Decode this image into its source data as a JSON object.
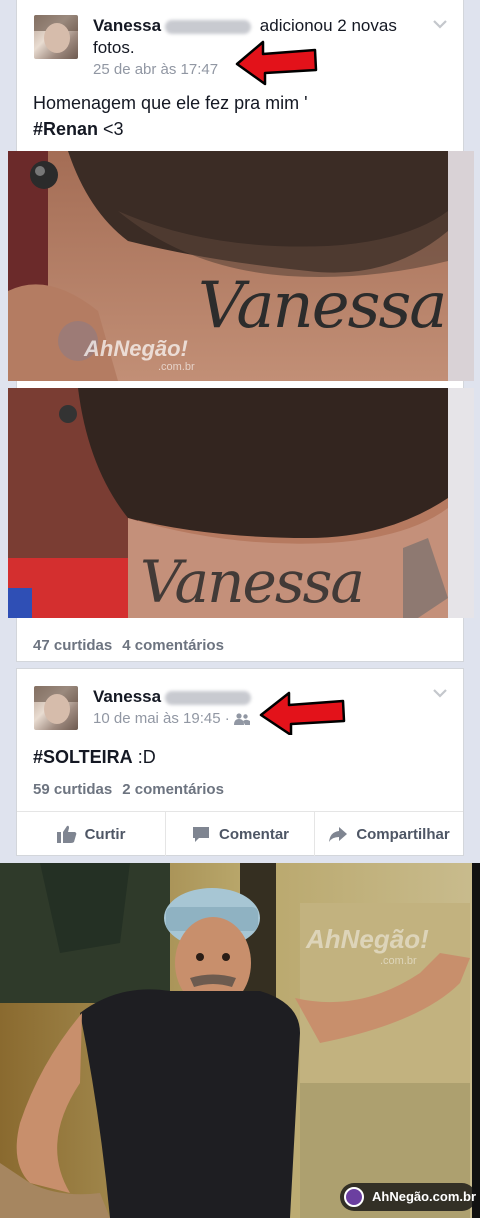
{
  "post1": {
    "author": "Vanessa",
    "action_text": "adicionou 2 novas fotos.",
    "timestamp": "25 de abr às 17:47",
    "text_line1": "Homenagem que ele fez pra mim '",
    "hashtag": "#Renan",
    "text_tail": " <3",
    "tattoo_text": "Vanessa",
    "watermark": "AhNegão!",
    "watermark_sub": ".com.br",
    "likes": "47 curtidas",
    "comments": "4 comentários"
  },
  "post2": {
    "author": "Vanessa",
    "timestamp": "10 de mai às 19:45",
    "separator": "·",
    "hashtag": "#SOLTEIRA",
    "text_tail": " :D",
    "likes": "59 curtidas",
    "comments": "2 comentários",
    "actions": {
      "like": "Curtir",
      "comment": "Comentar",
      "share": "Compartilhar"
    }
  },
  "meme": {
    "watermark": "AhNegão!",
    "watermark_sub": ".com.br",
    "badge": "AhNegão.com.br"
  },
  "colors": {
    "arrow": "#e3121a",
    "link_blue": "#3b5998",
    "meta_gray": "#9197a3"
  },
  "icons": [
    "chevron-down-icon",
    "red-arrow-icon",
    "friends-icon",
    "like-icon",
    "comment-icon",
    "share-icon"
  ]
}
